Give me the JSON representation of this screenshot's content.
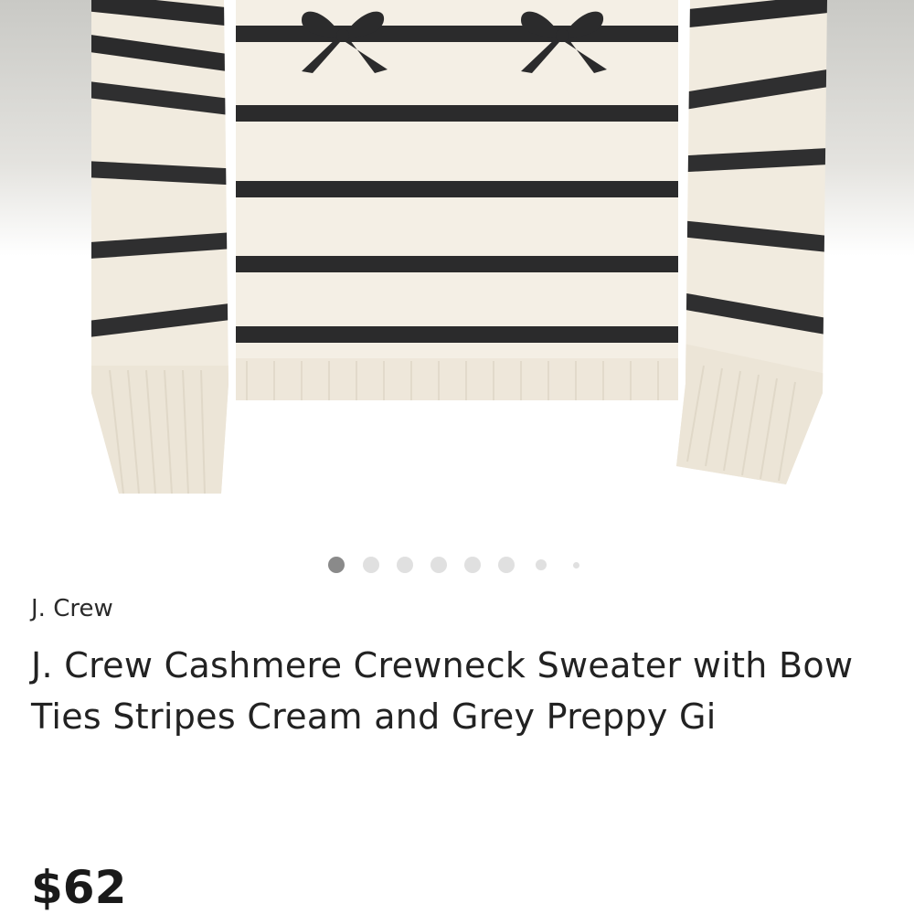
{
  "listing": {
    "brand": "J. Crew",
    "title": "J. Crew Cashmere Crewneck Sweater with Bow Ties Stripes Cream and Grey Preppy Gi",
    "price": "$62"
  },
  "gallery": {
    "photo_count": 8,
    "active_photo": 1,
    "image_subject": "cream sweater with charcoal stripes and bow motifs"
  },
  "colors": {
    "sweater_cream": "#f2ece0",
    "stripe_charcoal": "#2b2b2c",
    "dot_active": "#8a8a8a",
    "dot_inactive": "#e0e0e0",
    "text": "#222222"
  }
}
